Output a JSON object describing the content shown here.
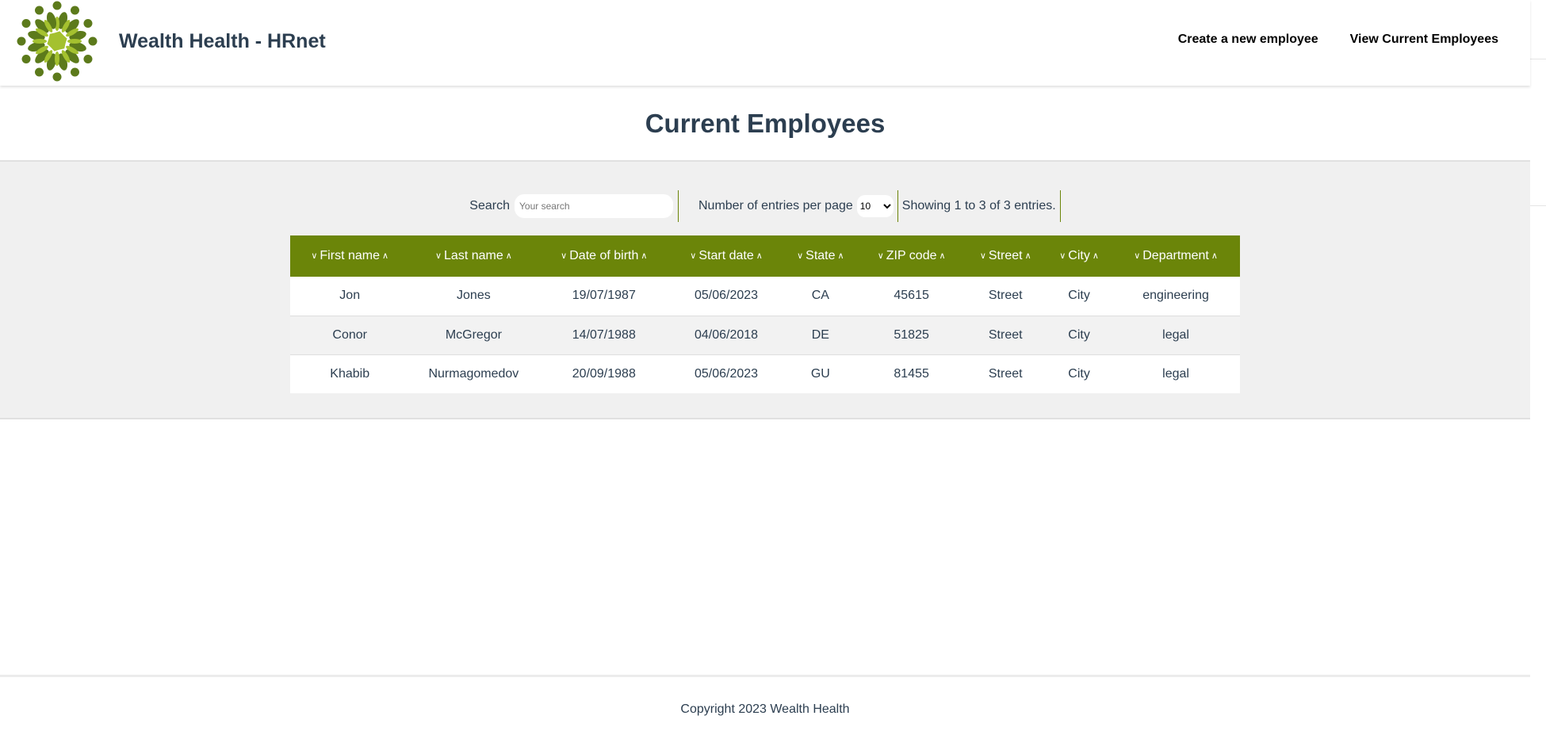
{
  "header": {
    "brand": "Wealth Health - HRnet",
    "nav": {
      "create": "Create a new employee",
      "view": "View Current Employees"
    }
  },
  "page_title": "Current Employees",
  "controls": {
    "search_label": "Search",
    "search_placeholder": "Your search",
    "entries_label": "Number of entries per page",
    "entries_value": "10",
    "showing": "Showing 1 to 3 of 3 entries."
  },
  "table": {
    "columns": [
      "First name",
      "Last name",
      "Date of birth",
      "Start date",
      "State",
      "ZIP code",
      "Street",
      "City",
      "Department"
    ],
    "rows": [
      [
        "Jon",
        "Jones",
        "19/07/1987",
        "05/06/2023",
        "CA",
        "45615",
        "Street",
        "City",
        "engineering"
      ],
      [
        "Conor",
        "McGregor",
        "14/07/1988",
        "04/06/2018",
        "DE",
        "51825",
        "Street",
        "City",
        "legal"
      ],
      [
        "Khabib",
        "Nurmagomedov",
        "20/09/1988",
        "05/06/2023",
        "GU",
        "81455",
        "Street",
        "City",
        "legal"
      ]
    ]
  },
  "footer": {
    "copyright": "Copyright 2023 Wealth Health"
  },
  "colors": {
    "accent": "#6b8509",
    "text": "#2c3e50",
    "logo_dark": "#5c7a1b",
    "logo_light": "#a4c12f"
  }
}
